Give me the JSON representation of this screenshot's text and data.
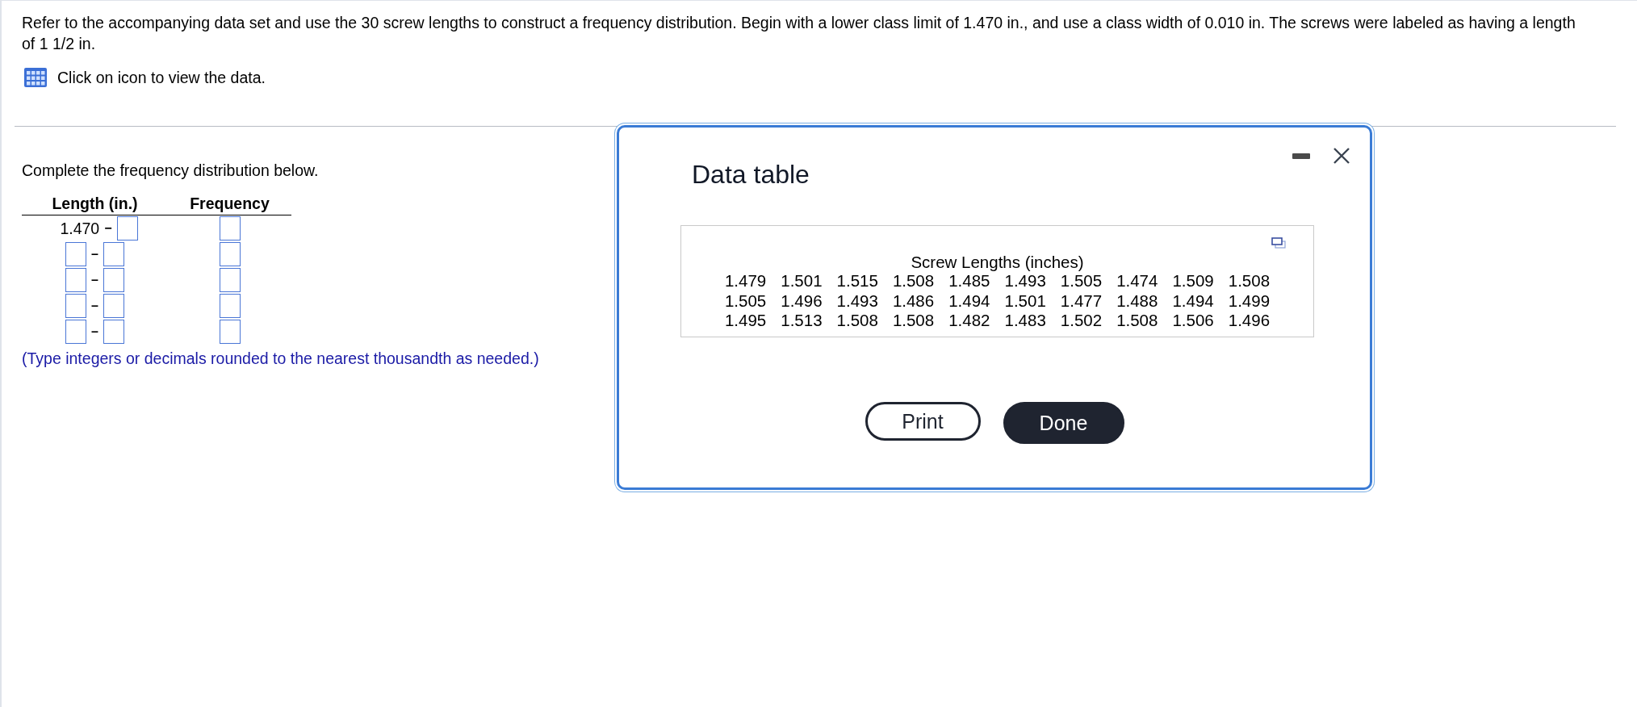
{
  "question": {
    "text": "Refer to the accompanying data set and use the 30 screw lengths to construct a frequency distribution. Begin with a lower class limit of 1.470 in., and use a class width of 0.010 in. The screws were labeled as having a length of 1 1/2 in.",
    "data_link": "Click on icon to view the data."
  },
  "exercise": {
    "instruction": "Complete the frequency distribution below.",
    "columns": [
      "Length (in.)",
      "Frequency"
    ],
    "rows": [
      {
        "kind": "given",
        "lower": "1.470",
        "separator": "−"
      },
      {
        "kind": "blank",
        "separator": "–"
      },
      {
        "kind": "blank",
        "separator": "–"
      },
      {
        "kind": "blank",
        "separator": "–"
      },
      {
        "kind": "blank",
        "separator": "–"
      }
    ],
    "hint": "(Type integers or decimals rounded to the nearest thousandth as needed.)"
  },
  "dialog": {
    "title": "Data table",
    "caption": "Screw Lengths (inches)",
    "rows": [
      [
        "1.479",
        "1.501",
        "1.515",
        "1.508",
        "1.485",
        "1.493",
        "1.505",
        "1.474",
        "1.509",
        "1.508"
      ],
      [
        "1.505",
        "1.496",
        "1.493",
        "1.486",
        "1.494",
        "1.501",
        "1.477",
        "1.488",
        "1.494",
        "1.499"
      ],
      [
        "1.495",
        "1.513",
        "1.508",
        "1.508",
        "1.482",
        "1.483",
        "1.502",
        "1.508",
        "1.506",
        "1.496"
      ]
    ],
    "buttons": [
      {
        "label": "Print",
        "kind": "secondary"
      },
      {
        "label": "Done",
        "kind": "primary"
      }
    ]
  }
}
